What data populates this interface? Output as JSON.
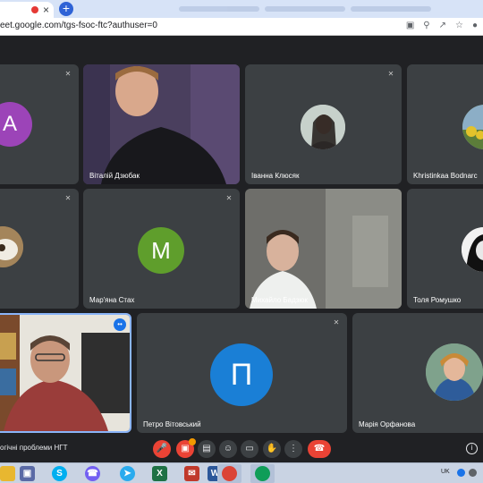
{
  "browser": {
    "tab_close": "×",
    "new_tab": "+",
    "url": "eet.google.com/tgs-fsoc-ftc?authuser=0",
    "address_icons": [
      "camera-icon",
      "search-icon",
      "share-icon",
      "star-icon",
      "profile-icon"
    ]
  },
  "participants": [
    {
      "name": "",
      "letter": "A",
      "color": "#9c44b8"
    },
    {
      "name": "Віталій Дзюбак",
      "video": true
    },
    {
      "name": "Іванна Клюсяк",
      "photo": true
    },
    {
      "name": "Khristinkaa Bodnarc",
      "photo": true
    },
    {
      "name": "",
      "photo": true
    },
    {
      "name": "Мар'яна Стах",
      "letter": "M",
      "color": "#5f9e2c"
    },
    {
      "name": "Михайло Бадзюк",
      "video": true
    },
    {
      "name": "Толя Ромушко",
      "photo": true
    },
    {
      "name": "",
      "video": true,
      "speaking": true
    },
    {
      "name": "Петро Вітовський",
      "letter": "П",
      "color": "#1a7fd6"
    },
    {
      "name": "Марія Орфанова",
      "photo": true
    }
  ],
  "meeting": {
    "title": "огічні проблеми НГТ",
    "controls": [
      "mic-off-icon",
      "camera-off-icon",
      "captions-icon",
      "emoji-icon",
      "present-icon",
      "raise-hand-icon",
      "more-icon",
      "hangup-icon"
    ]
  },
  "taskbar": {
    "lang": "UK",
    "apps": [
      "explorer",
      "save",
      "skype",
      "viber",
      "telegram",
      "excel",
      "email",
      "word",
      "chrome",
      "chrome-active"
    ]
  }
}
